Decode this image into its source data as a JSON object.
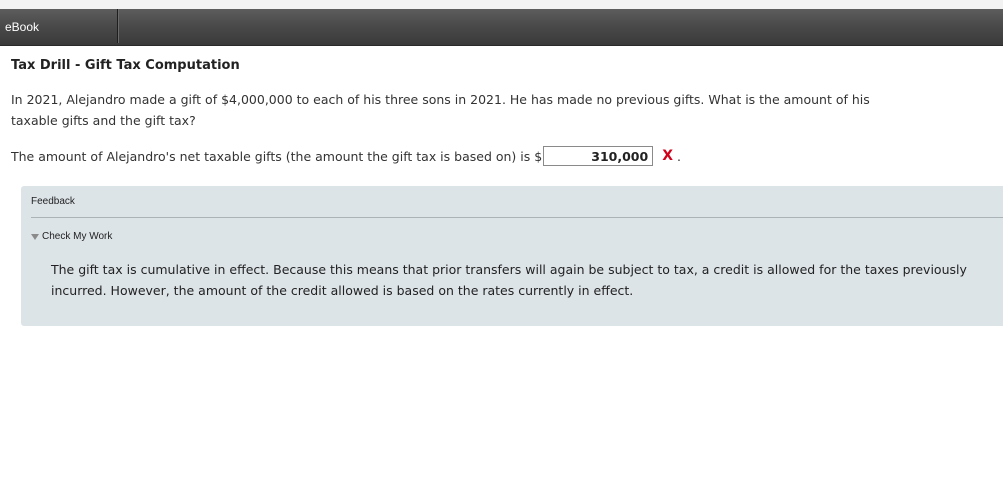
{
  "nav": {
    "tab_label": "eBook"
  },
  "problem": {
    "title": "Tax Drill - Gift Tax Computation",
    "question": "In 2021, Alejandro made a gift of $4,000,000 to each of his three sons in 2021. He has made no previous gifts. What is the amount of his taxable gifts and the gift tax?",
    "answer_prompt": "The amount of Alejandro's net taxable gifts (the amount the gift tax is based on) is $",
    "answer_value": "310,000",
    "result_mark": "X",
    "trailing_period": "."
  },
  "feedback": {
    "label": "Feedback",
    "toggle_label": "Check My Work",
    "text": "The gift tax is cumulative in effect. Because this means that prior transfers will again be subject to tax, a credit is allowed for the taxes previously incurred. However, the amount of the credit allowed is based on the rates currently in effect."
  },
  "colors": {
    "error": "#d0021b",
    "feedback_bg": "#dde4e8",
    "tabbar": "#4a4a4a"
  }
}
